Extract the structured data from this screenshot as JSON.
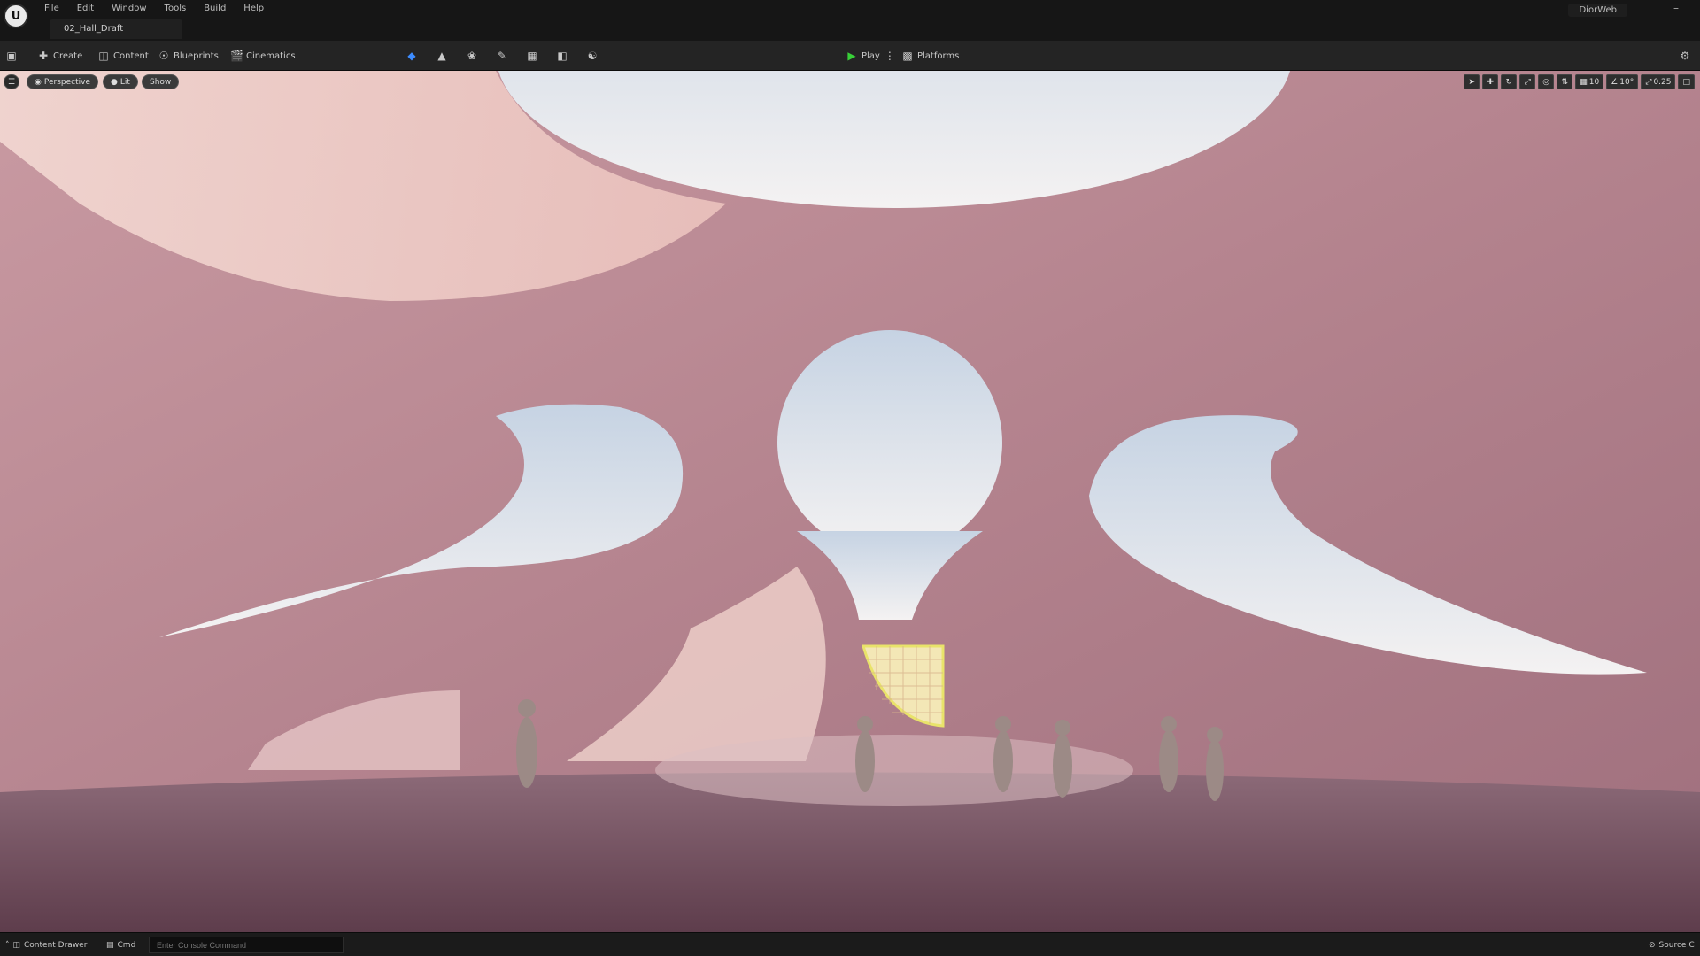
{
  "app": {
    "logo_text": "U",
    "project_name": "DiorWeb",
    "minimize": "–"
  },
  "menu": [
    "File",
    "Edit",
    "Window",
    "Tools",
    "Build",
    "Help"
  ],
  "tab": {
    "label": "02_Hall_Draft"
  },
  "toolbar": {
    "create": "Create",
    "content": "Content",
    "blueprints": "Blueprints",
    "cinematics": "Cinematics",
    "play": "Play",
    "platforms": "Platforms"
  },
  "viewport": {
    "perspective": "Perspective",
    "lit": "Lit",
    "show": "Show",
    "grid_snap": "10",
    "rotation_snap": "10°",
    "scale_snap": "0.25"
  },
  "statusbar": {
    "content_drawer": "Content Drawer",
    "cmd": "Cmd",
    "console_placeholder": "Enter Console Command",
    "source_control": "Source C"
  },
  "colors": {
    "accent_blue": "#3d8cff",
    "play_green": "#38d038",
    "wall_pink": "#b98893",
    "sky": "#dfe6ee"
  }
}
